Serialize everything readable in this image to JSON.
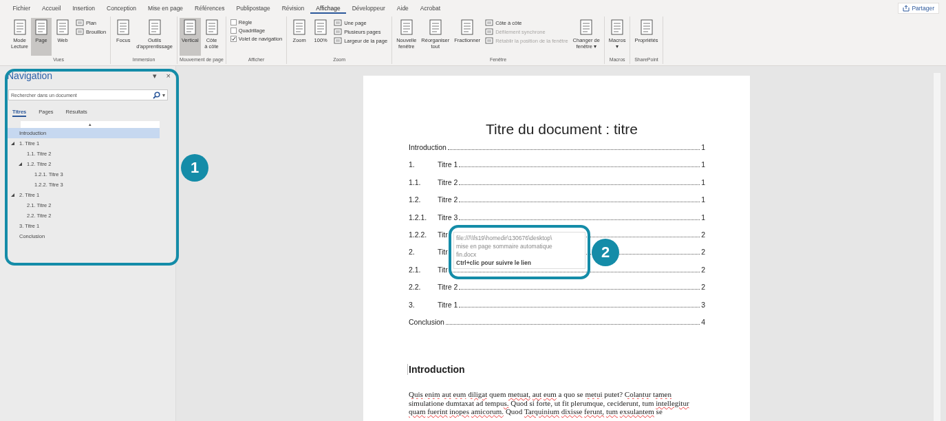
{
  "menu_tabs": [
    {
      "label": "Fichier",
      "selected": false
    },
    {
      "label": "Accueil",
      "selected": false
    },
    {
      "label": "Insertion",
      "selected": false
    },
    {
      "label": "Conception",
      "selected": false
    },
    {
      "label": "Mise en page",
      "selected": false
    },
    {
      "label": "Références",
      "selected": false
    },
    {
      "label": "Publipostage",
      "selected": false
    },
    {
      "label": "Révision",
      "selected": false
    },
    {
      "label": "Affichage",
      "selected": true
    },
    {
      "label": "Développeur",
      "selected": false
    },
    {
      "label": "Aide",
      "selected": false
    },
    {
      "label": "Acrobat",
      "selected": false
    }
  ],
  "share_button": {
    "label": "Partager"
  },
  "ribbon": [
    {
      "label": "Vues",
      "items": [
        {
          "kind": "large",
          "lines": [
            "Mode",
            "Lecture"
          ],
          "selected": false
        },
        {
          "kind": "large",
          "lines": [
            "Page"
          ],
          "selected": true
        },
        {
          "kind": "large",
          "lines": [
            "Web"
          ],
          "selected": false
        },
        {
          "kind": "small",
          "label": "Plan",
          "disabled": false
        },
        {
          "kind": "small",
          "label": "Brouillon",
          "disabled": false
        }
      ]
    },
    {
      "label": "Immersion",
      "items": [
        {
          "kind": "large",
          "lines": [
            "Focus"
          ]
        },
        {
          "kind": "large",
          "lines": [
            "Outils",
            "d'apprentissage"
          ]
        }
      ]
    },
    {
      "label": "Mouvement de page",
      "items": [
        {
          "kind": "large",
          "lines": [
            "Vertical"
          ],
          "selected": true
        },
        {
          "kind": "large",
          "lines": [
            "Côte",
            "à côte"
          ],
          "selected": false
        }
      ]
    },
    {
      "label": "Afficher",
      "items": [
        {
          "kind": "check",
          "label": "Règle",
          "checked": false
        },
        {
          "kind": "check",
          "label": "Quadrillage",
          "checked": false
        },
        {
          "kind": "check",
          "label": "Volet de navigation",
          "checked": true
        }
      ]
    },
    {
      "label": "Zoom",
      "items": [
        {
          "kind": "large",
          "lines": [
            "Zoom"
          ]
        },
        {
          "kind": "large",
          "lines": [
            "100%"
          ]
        },
        {
          "kind": "small",
          "label": "Une page",
          "disabled": false
        },
        {
          "kind": "small",
          "label": "Plusieurs pages",
          "disabled": false
        },
        {
          "kind": "small",
          "label": "Largeur de la page",
          "disabled": false
        }
      ]
    },
    {
      "label": "Fenêtre",
      "items": [
        {
          "kind": "large",
          "lines": [
            "Nouvelle",
            "fenêtre"
          ]
        },
        {
          "kind": "large",
          "lines": [
            "Réorganiser",
            "tout"
          ]
        },
        {
          "kind": "large",
          "lines": [
            "Fractionner"
          ]
        },
        {
          "kind": "small",
          "label": "Côte à côte",
          "disabled": false
        },
        {
          "kind": "small",
          "label": "Défilement synchrone",
          "disabled": true
        },
        {
          "kind": "small",
          "label": "Rétablir la position de la fenêtre",
          "disabled": true
        },
        {
          "kind": "large",
          "lines": [
            "Changer de",
            "fenêtre ▾"
          ]
        }
      ]
    },
    {
      "label": "Macros",
      "items": [
        {
          "kind": "large",
          "lines": [
            "Macros",
            "▾"
          ]
        }
      ]
    },
    {
      "label": "SharePoint",
      "items": [
        {
          "kind": "large",
          "lines": [
            "Propriétés"
          ]
        }
      ]
    }
  ],
  "navigation": {
    "title": "Navigation",
    "menu_caret": "▾",
    "close": "×",
    "search": {
      "placeholder": "Rechercher dans un document",
      "caret": "▾"
    },
    "tabs": [
      {
        "label": "Titres",
        "selected": true
      },
      {
        "label": "Pages",
        "selected": false
      },
      {
        "label": "Résultats",
        "selected": false
      }
    ],
    "collapse_bar": "▴",
    "headings": [
      {
        "label": "Introduction",
        "selected": true
      },
      {
        "label": "1. Titre 1",
        "selected": false,
        "expanded": true,
        "children": [
          {
            "label": "1.1. Titre 2",
            "selected": false
          },
          {
            "label": "1.2. Titre 2",
            "selected": false,
            "expanded": true,
            "children": [
              {
                "label": "1.2.1. Titre 3",
                "selected": false
              },
              {
                "label": "1.2.2. Titre 3",
                "selected": false
              }
            ]
          }
        ]
      },
      {
        "label": "2. Titre 1",
        "selected": false,
        "expanded": true,
        "children": [
          {
            "label": "2.1. Titre 2",
            "selected": false
          },
          {
            "label": "2.2. Titre 2",
            "selected": false
          }
        ]
      },
      {
        "label": "3. Titre 1",
        "selected": false
      },
      {
        "label": "Conclusion",
        "selected": false
      }
    ]
  },
  "document": {
    "title": "Titre du document : titre",
    "toc": [
      {
        "title": "Introduction",
        "page": "1"
      },
      {
        "number": "1.",
        "title": "Titre 1",
        "page": "1"
      },
      {
        "number": "1.1.",
        "title": "Titre 2",
        "page": "1"
      },
      {
        "number": "1.2.",
        "title": "Titre 2",
        "page": "1"
      },
      {
        "number": "1.2.1.",
        "title": "Titre 3",
        "page": "1"
      },
      {
        "number": "1.2.2.",
        "title": "Titr",
        "page": "2"
      },
      {
        "number": "2.",
        "title": "Titr",
        "page": "2"
      },
      {
        "number": "2.1.",
        "title": "Titr",
        "page": "2"
      },
      {
        "number": "2.2.",
        "title": "Titre 2",
        "page": "2"
      },
      {
        "number": "3.",
        "title": "Titre 1",
        "page": "3"
      },
      {
        "title": "Conclusion",
        "page": "4"
      }
    ],
    "tooltip": {
      "path_lines": [
        "file:///\\\\fs19\\homedir\\130676\\desktop\\",
        "mise en page sommaire automatique",
        "fin.docx"
      ],
      "hint": "Ctrl+clic pour suivre le lien"
    },
    "heading": "Introduction",
    "paragraph": [
      {
        "text": "Quis enim aut eum diligat",
        "flagged": true
      },
      {
        "text": " quem ",
        "flagged": false
      },
      {
        "text": "metuat, aut eum",
        "flagged": true
      },
      {
        "text": " a quo se ",
        "flagged": false
      },
      {
        "text": "metui",
        "flagged": true
      },
      {
        "text": " putet? ",
        "flagged": false
      },
      {
        "text": "Colantur tamen simulatione dumtaxat",
        "flagged": true
      },
      {
        "text": " ad ",
        "flagged": false
      },
      {
        "text": "tempus.",
        "flagged": true
      },
      {
        "text": " Quod si forte, ut fit ",
        "flagged": false
      },
      {
        "text": "plerumque, ceciderunt, tum intellegitur quam fuerint inopes amicorum.",
        "flagged": true
      },
      {
        "text": " Quod ",
        "flagged": false
      },
      {
        "text": "Tarquinium dixisse ferunt, tum exsulantem",
        "flagged": true
      },
      {
        "text": " se",
        "flagged": false
      }
    ]
  },
  "annotations": [
    {
      "number": "1"
    },
    {
      "number": "2"
    }
  ]
}
